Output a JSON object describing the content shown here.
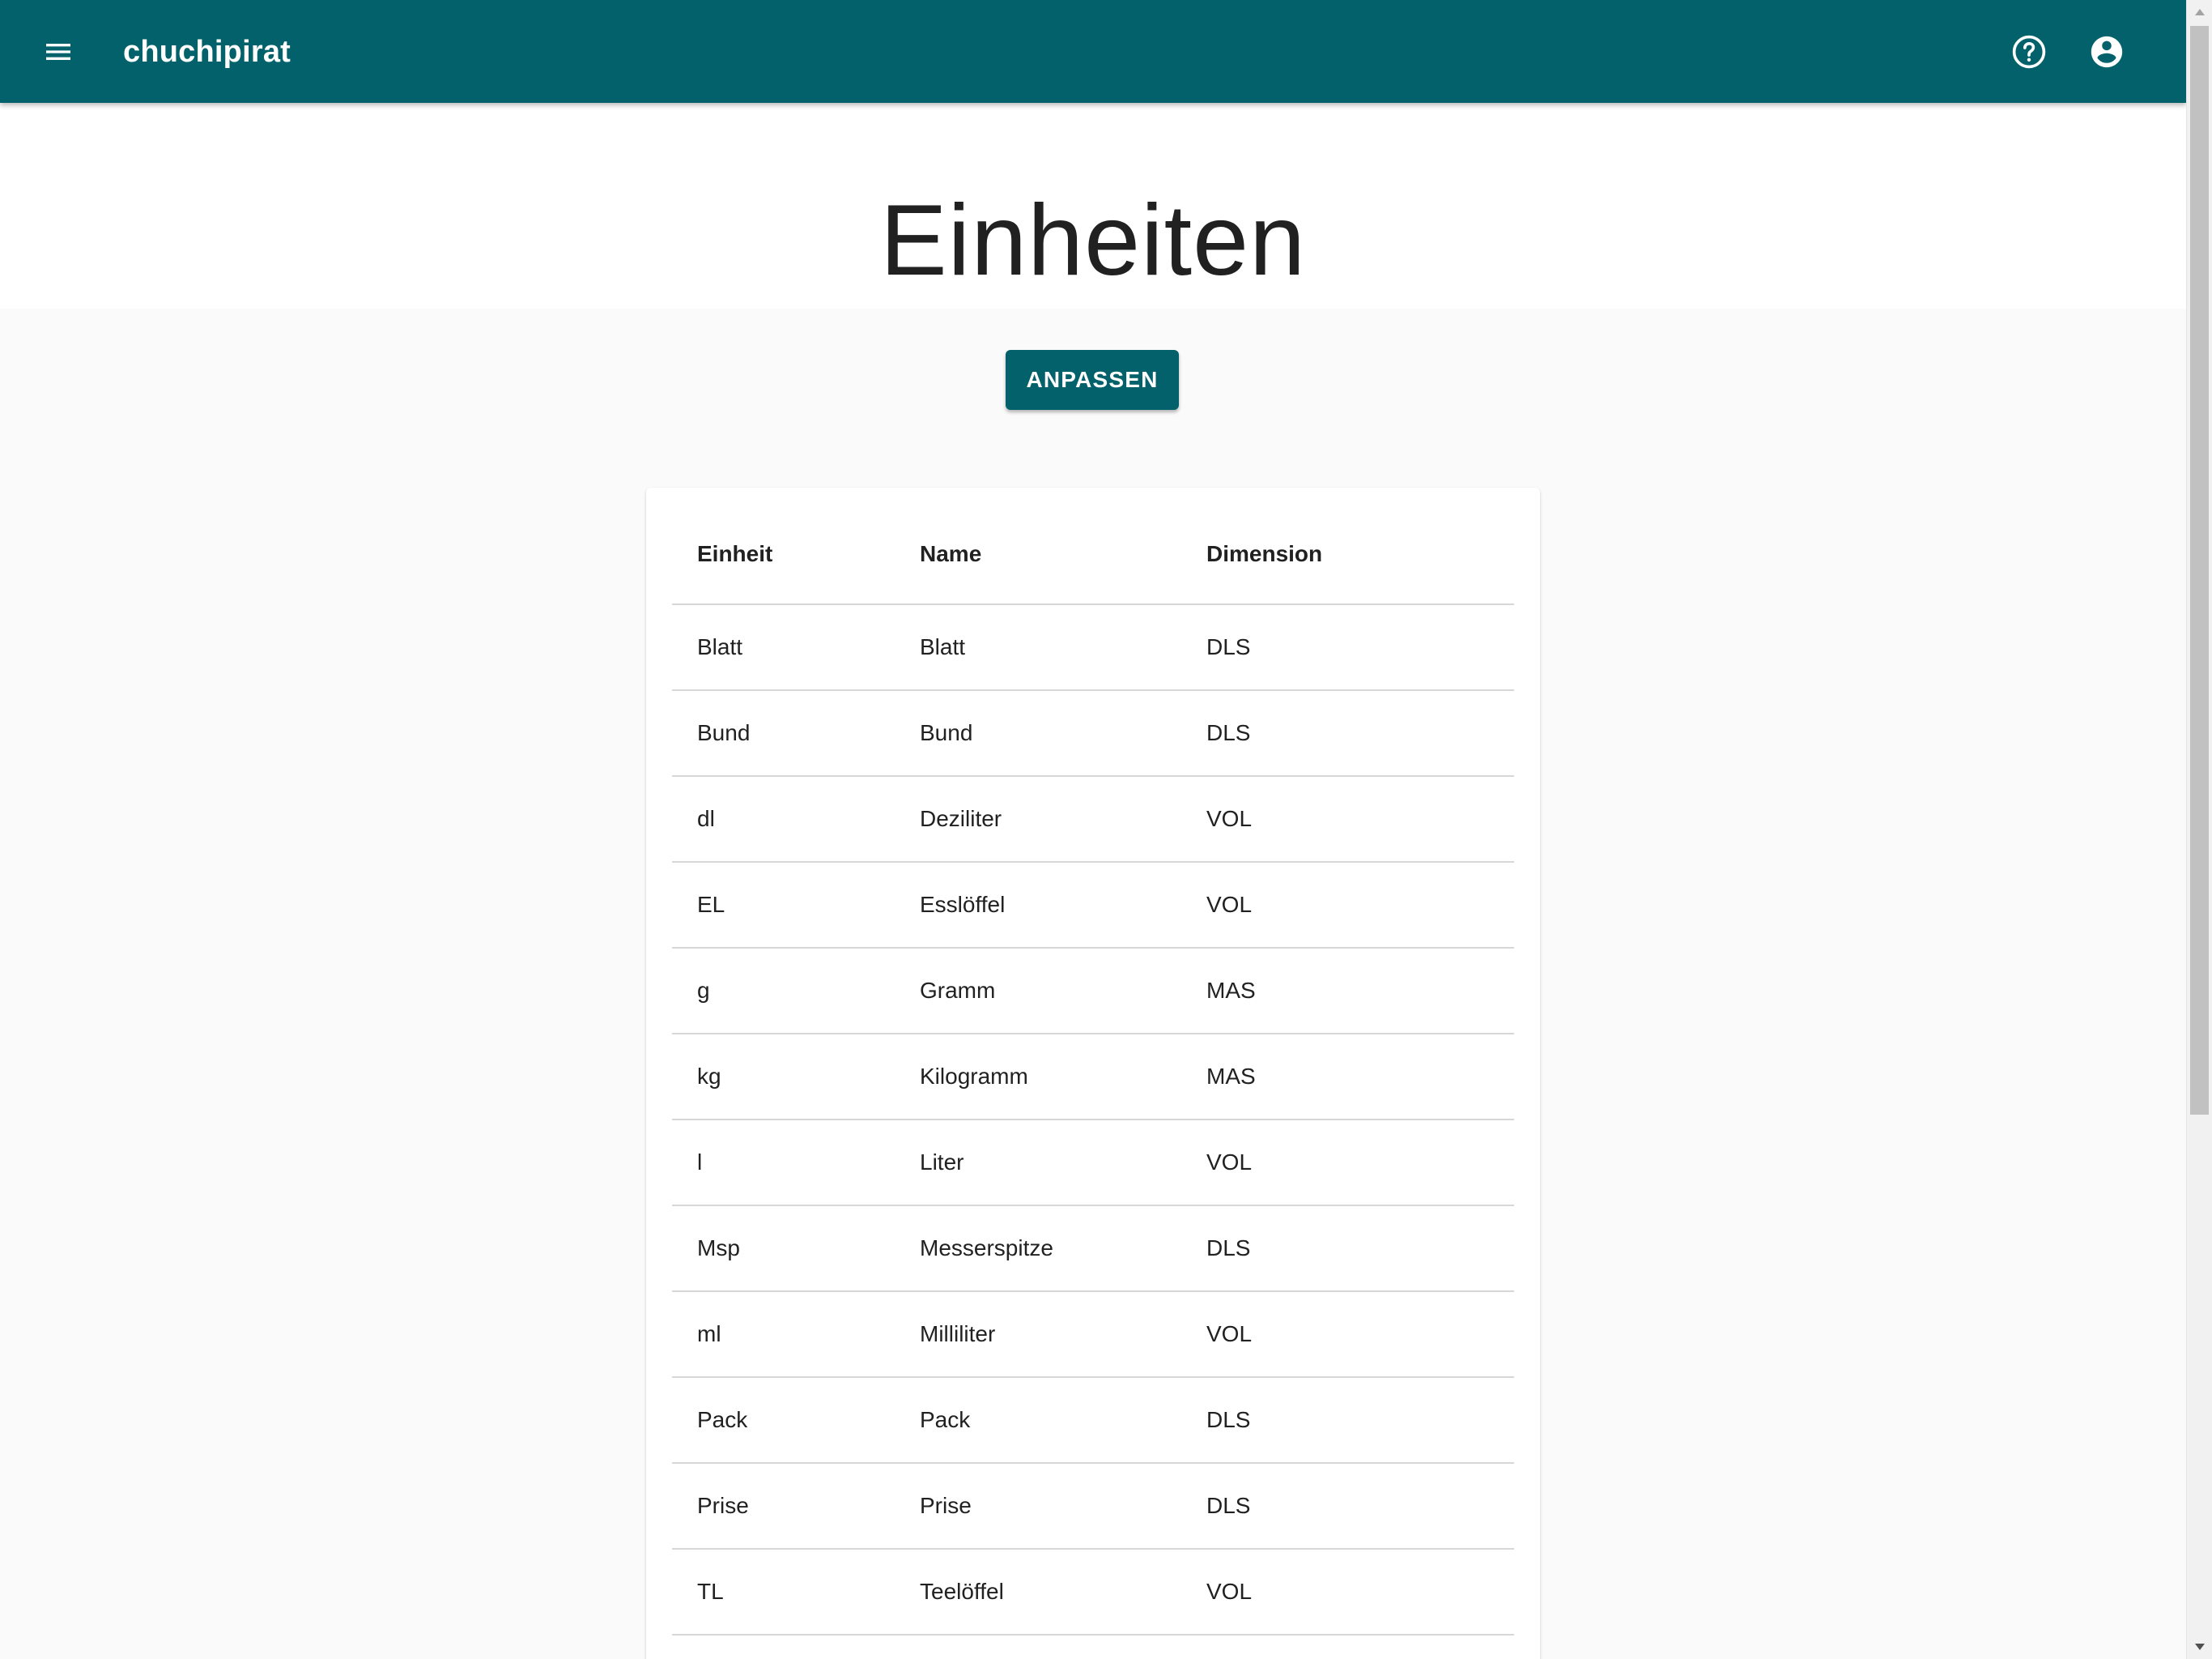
{
  "appbar": {
    "title": "chuchipirat",
    "menu_icon": "menu-icon",
    "help_icon": "help-circle-icon",
    "account_icon": "account-circle-icon",
    "color": "#02616a"
  },
  "page": {
    "title": "Einheiten"
  },
  "actions": {
    "customize_label": "ANPASSEN"
  },
  "table": {
    "headers": [
      "Einheit",
      "Name",
      "Dimension"
    ],
    "rows": [
      [
        "Blatt",
        "Blatt",
        "DLS"
      ],
      [
        "Bund",
        "Bund",
        "DLS"
      ],
      [
        "dl",
        "Deziliter",
        "VOL"
      ],
      [
        "EL",
        "Esslöffel",
        "VOL"
      ],
      [
        "g",
        "Gramm",
        "MAS"
      ],
      [
        "kg",
        "Kilogramm",
        "MAS"
      ],
      [
        "l",
        "Liter",
        "VOL"
      ],
      [
        "Msp",
        "Messerspitze",
        "DLS"
      ],
      [
        "ml",
        "Milliliter",
        "VOL"
      ],
      [
        "Pack",
        "Pack",
        "DLS"
      ],
      [
        "Prise",
        "Prise",
        "DLS"
      ],
      [
        "TL",
        "Teelöffel",
        "VOL"
      ]
    ]
  }
}
